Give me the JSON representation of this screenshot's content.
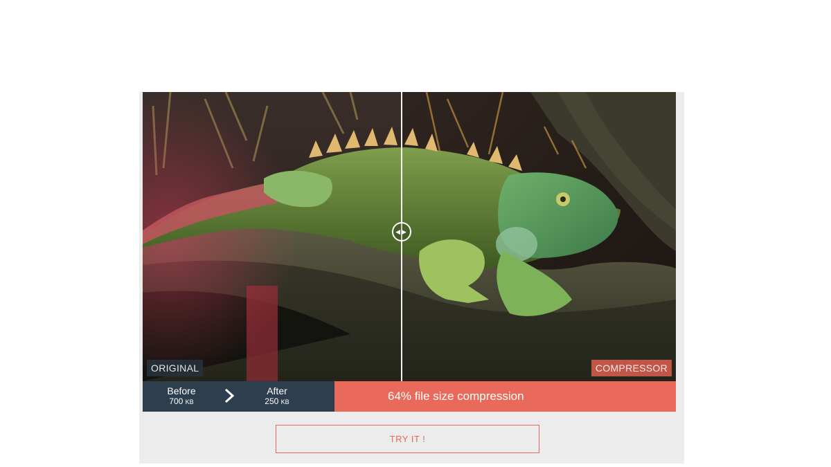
{
  "viewer": {
    "label_original": "ORIGINAL",
    "label_compressed": "COMPRESSOR"
  },
  "stats": {
    "before_label": "Before",
    "before_size": "700",
    "before_unit": "KB",
    "after_label": "After",
    "after_size": "250",
    "after_unit": "KB"
  },
  "compression": {
    "text": "64% file size compression"
  },
  "cta": {
    "label": "TRY IT !"
  },
  "colors": {
    "accent": "#e9695a",
    "stats_bg": "#2d3e4e",
    "panel_bg": "#ececec"
  }
}
